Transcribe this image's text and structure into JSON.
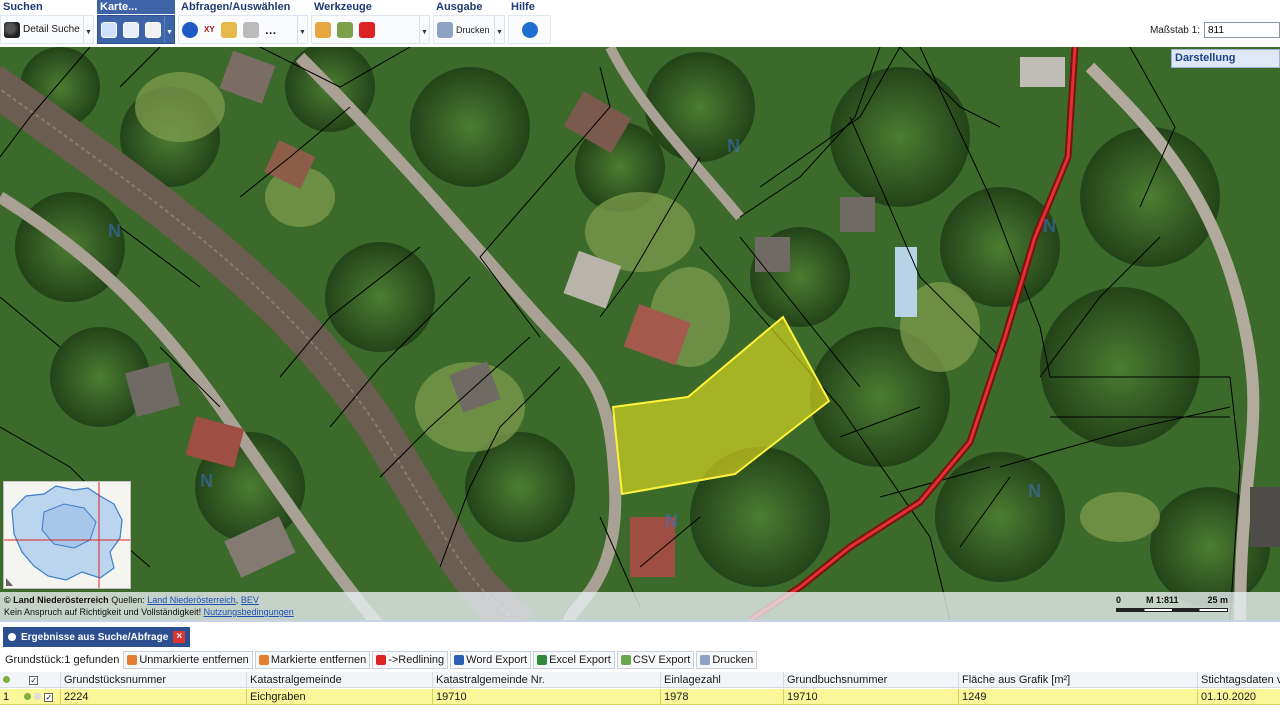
{
  "toolbar": {
    "groups": [
      {
        "title": "Suchen",
        "buttons": [
          "Detail Suche"
        ]
      },
      {
        "title": "Karte..."
      },
      {
        "title": "Abfragen/Auswählen"
      },
      {
        "title": "Werkzeuge"
      },
      {
        "title": "Ausgabe",
        "buttons": [
          "Drucken"
        ]
      },
      {
        "title": "Hilfe"
      }
    ],
    "scale_label": "Maßstab 1:",
    "scale_value": "811",
    "abfragen_xy_label": "XY"
  },
  "map": {
    "panel_title": "Darstellung",
    "credits": {
      "copyright": "© Land Niederösterreich",
      "sources_label": "Quellen:",
      "source_link_1": "Land Niederösterreich",
      "separator": ",",
      "source_link_2": "BEV",
      "disclaimer": "Kein Anspruch auf Richtigkeit und Vollständigkeit!",
      "terms_link": "Nutzungsbedingungen"
    },
    "scalebar": {
      "left": "0",
      "middle": "M 1:811",
      "right": "25 m"
    },
    "watermark_letter": "N",
    "colors": {
      "highlight": "#e6e21e",
      "red_line": "#d61f1f",
      "parcel_line": "#000000"
    }
  },
  "results": {
    "tab_title": "Ergebnisse aus Suche/Abfrage",
    "close_glyph": "×",
    "count_text": "Grundstück:1 gefunden",
    "actions": [
      "Unmarkierte entfernen",
      "Markierte entfernen",
      "->Redlining",
      "Word Export",
      "Excel Export",
      "CSV Export",
      "Drucken"
    ],
    "columns": [
      "Grundstücksnummer",
      "Katastralgemeinde",
      "Katastralgemeinde Nr.",
      "Einlagezahl",
      "Grundbuchsnummer",
      "Fläche aus Grafik [m²]",
      "Stichtagsdaten vom"
    ],
    "rows": [
      {
        "index": "1",
        "cells": [
          "2224",
          "Eichgraben",
          "19710",
          "1978",
          "19710",
          "1249",
          "01.10.2020"
        ]
      }
    ]
  }
}
